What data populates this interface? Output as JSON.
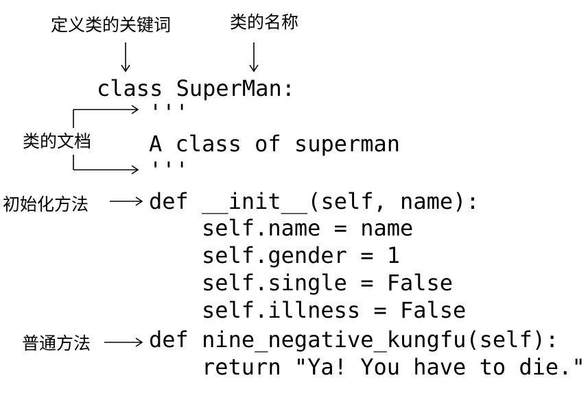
{
  "annotations": {
    "define_keyword": "定义类的关键词",
    "class_name": "类的名称",
    "class_doc": "类的文档",
    "init_method": "初始化方法",
    "normal_method": "普通方法"
  },
  "code": {
    "class_line": "class SuperMan:",
    "doc_open": "'''",
    "doc_text": "A class of superman",
    "doc_close": "'''",
    "init_def": "def __init__(self, name):",
    "init_body": [
      "self.name = name",
      "self.gender = 1",
      "self.single = False",
      "self.illness = False"
    ],
    "method_def": "def nine_negative_kungfu(self):",
    "method_body": "return \"Ya! You have to die.\""
  }
}
